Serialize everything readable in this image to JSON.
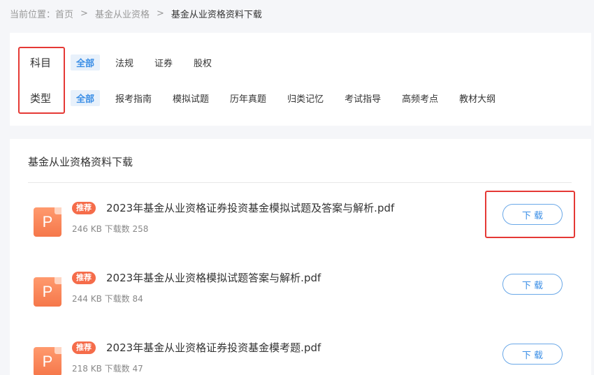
{
  "breadcrumb": {
    "prefix": "当前位置：",
    "home": "首页",
    "sep1": ">",
    "category": "基金从业资格",
    "sep2": ">",
    "current": "基金从业资格资料下载"
  },
  "filters": {
    "subject": {
      "label": "科目",
      "options": [
        "全部",
        "法规",
        "证券",
        "股权"
      ],
      "selected": "全部"
    },
    "type": {
      "label": "类型",
      "options": [
        "全部",
        "报考指南",
        "模拟试题",
        "历年真题",
        "归类记忆",
        "考试指导",
        "高频考点",
        "教材大纲"
      ],
      "selected": "全部"
    }
  },
  "section": {
    "title": "基金从业资格资料下载"
  },
  "files": [
    {
      "badge": "推荐",
      "icon_letter": "P",
      "name": "2023年基金从业资格证券投资基金模拟试题及答案与解析.pdf",
      "meta": "246 KB 下载数 258",
      "download_label": "下载"
    },
    {
      "badge": "推荐",
      "icon_letter": "P",
      "name": "2023年基金从业资格模拟试题答案与解析.pdf",
      "meta": "244 KB 下载数 84",
      "download_label": "下载"
    },
    {
      "badge": "推荐",
      "icon_letter": "P",
      "name": "2023年基金从业资格证券投资基金模考题.pdf",
      "meta": "218 KB 下载数 47",
      "download_label": "下载"
    }
  ],
  "colors": {
    "accent": "#3a8ee6",
    "badge": "#f56c4a",
    "highlight_box": "#e53935"
  },
  "icons": {
    "file": "pdf-file-icon"
  }
}
